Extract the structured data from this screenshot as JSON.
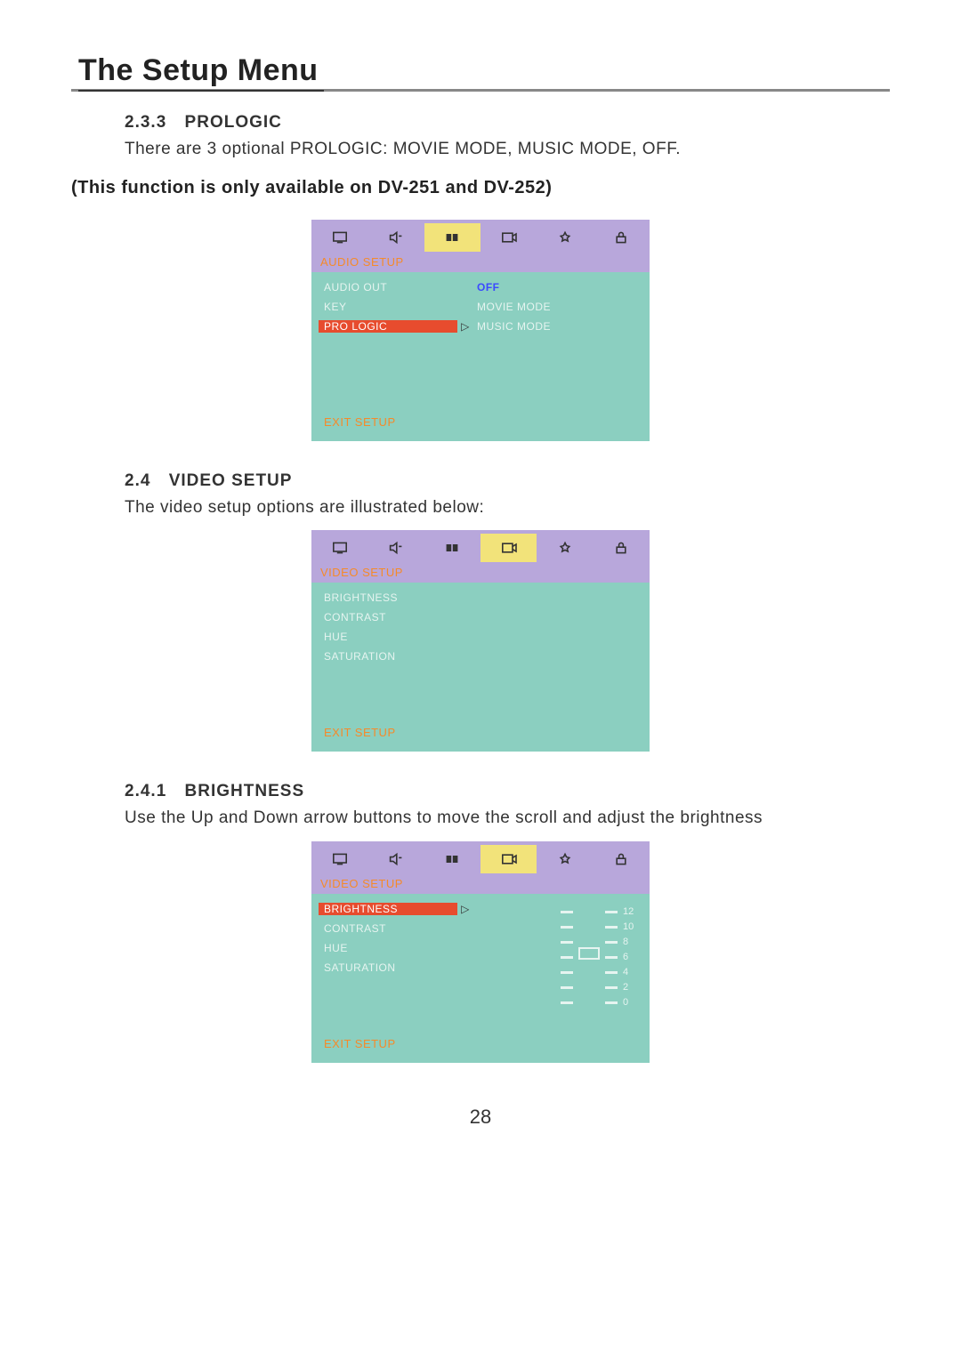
{
  "page_title": "The Setup Menu",
  "page_number": "28",
  "sec_233_num": "2.3.3",
  "sec_233_title": "PROLOGIC",
  "sec_233_body": "There are 3 optional PROLOGIC: MOVIE MODE, MUSIC MODE, OFF.",
  "bold_note": "(This function is only available on DV-251 and DV-252)",
  "sec_24_num": "2.4",
  "sec_24_title": "VIDEO SETUP",
  "sec_24_body": "The video setup options are illustrated below:",
  "sec_241_num": "2.4.1",
  "sec_241_title": "BRIGHTNESS",
  "sec_241_body": "Use the Up and Down arrow buttons to move the scroll and adjust the brightness",
  "osd1": {
    "section": "AUDIO SETUP",
    "rows": [
      {
        "left": "AUDIO OUT",
        "right": "OFF",
        "right_active": true
      },
      {
        "left": "KEY",
        "right": "MOVIE MODE"
      },
      {
        "left": "PRO LOGIC",
        "selected": true,
        "arrow": true,
        "right": "MUSIC MODE"
      }
    ],
    "exit": "EXIT SETUP"
  },
  "osd2": {
    "section": "VIDEO SETUP",
    "rows": [
      {
        "left": "BRIGHTNESS"
      },
      {
        "left": "CONTRAST"
      },
      {
        "left": "HUE"
      },
      {
        "left": "SATURATION"
      }
    ],
    "exit": "EXIT SETUP"
  },
  "osd3": {
    "section": "VIDEO SETUP",
    "rows": [
      {
        "left": "BRIGHTNESS",
        "selected": true,
        "arrow": true
      },
      {
        "left": "CONTRAST"
      },
      {
        "left": "HUE"
      },
      {
        "left": "SATURATION"
      }
    ],
    "exit": "EXIT SETUP",
    "scale": [
      "12",
      "10",
      "8",
      "6",
      "4",
      "2",
      "0"
    ]
  }
}
